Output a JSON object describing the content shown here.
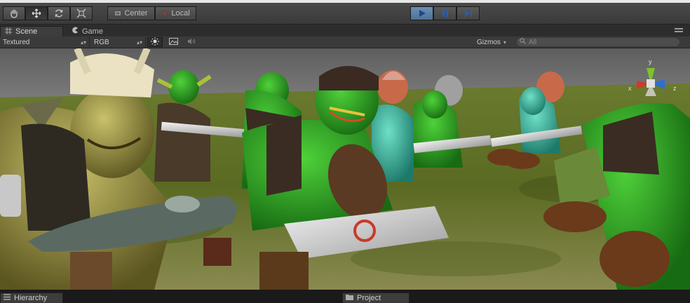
{
  "toolbar": {
    "tools": [
      {
        "name": "hand-tool",
        "icon": "hand-icon"
      },
      {
        "name": "move-tool",
        "icon": "move-icon",
        "active": true
      },
      {
        "name": "rotate-tool",
        "icon": "rotate-icon"
      },
      {
        "name": "scale-tool",
        "icon": "scale-icon"
      }
    ],
    "pivot_label": "Center",
    "space_label": "Local",
    "playback": [
      "play",
      "pause",
      "step"
    ]
  },
  "tabs": {
    "scene": "Scene",
    "game": "Game"
  },
  "scene_options": {
    "shading_mode": "Textured",
    "render_mode": "RGB",
    "gizmos_label": "Gizmos",
    "search_placeholder": "All"
  },
  "gizmo_axes": {
    "y": "y",
    "x": "x",
    "z": "z"
  },
  "bottom_tabs": {
    "hierarchy": "Hierarchy",
    "project": "Project"
  },
  "colors": {
    "play_active": "#5a7fa8",
    "axis_x": "#d03a2a",
    "axis_y": "#7cc42a",
    "axis_z": "#2f6fd0",
    "sky": "#6c6c6c",
    "ground": "#6f7a2a"
  }
}
